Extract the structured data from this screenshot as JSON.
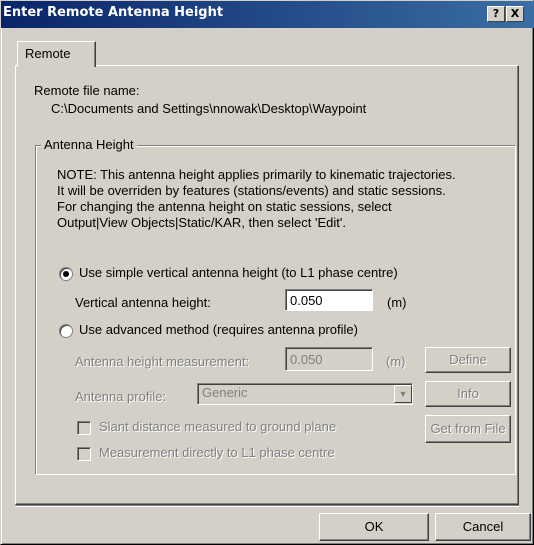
{
  "window": {
    "title": "Enter Remote Antenna Height",
    "help_label": "?",
    "close_label": "X"
  },
  "tabs": [
    {
      "label": "Remote",
      "active": true
    }
  ],
  "remote_file": {
    "label": "Remote file name:",
    "path": "C:\\Documents and Settings\\nnowak\\Desktop\\Waypoint"
  },
  "antenna_height": {
    "group_title": "Antenna Height",
    "note_lines": [
      "NOTE: This antenna height applies primarily to kinematic trajectories.",
      "It will be overriden by features (stations/events) and static sessions.",
      "For changing the antenna height on static sessions, select",
      "Output|View Objects|Static/KAR, then select 'Edit'."
    ],
    "simple": {
      "radio_label": "Use simple vertical antenna height (to L1 phase centre)",
      "selected": true,
      "field_label": "Vertical antenna height:",
      "value": "0.050",
      "unit": "(m)"
    },
    "advanced": {
      "radio_label": "Use advanced method (requires antenna profile)",
      "selected": false,
      "measurement_label": "Antenna height measurement:",
      "measurement_value": "0.050",
      "measurement_unit": "(m)",
      "define_label": "Define",
      "profile_label": "Antenna profile:",
      "profile_value": "Generic",
      "info_label": "Info",
      "get_from_file_label": "Get from File",
      "slant_label": "Slant distance measured to ground plane",
      "direct_label": "Measurement directly to L1 phase centre"
    }
  },
  "buttons": {
    "ok": "OK",
    "cancel": "Cancel"
  },
  "colors": {
    "title_bar": "#0a246a",
    "face": "#d4d0c8",
    "disabled_text": "#808080"
  }
}
